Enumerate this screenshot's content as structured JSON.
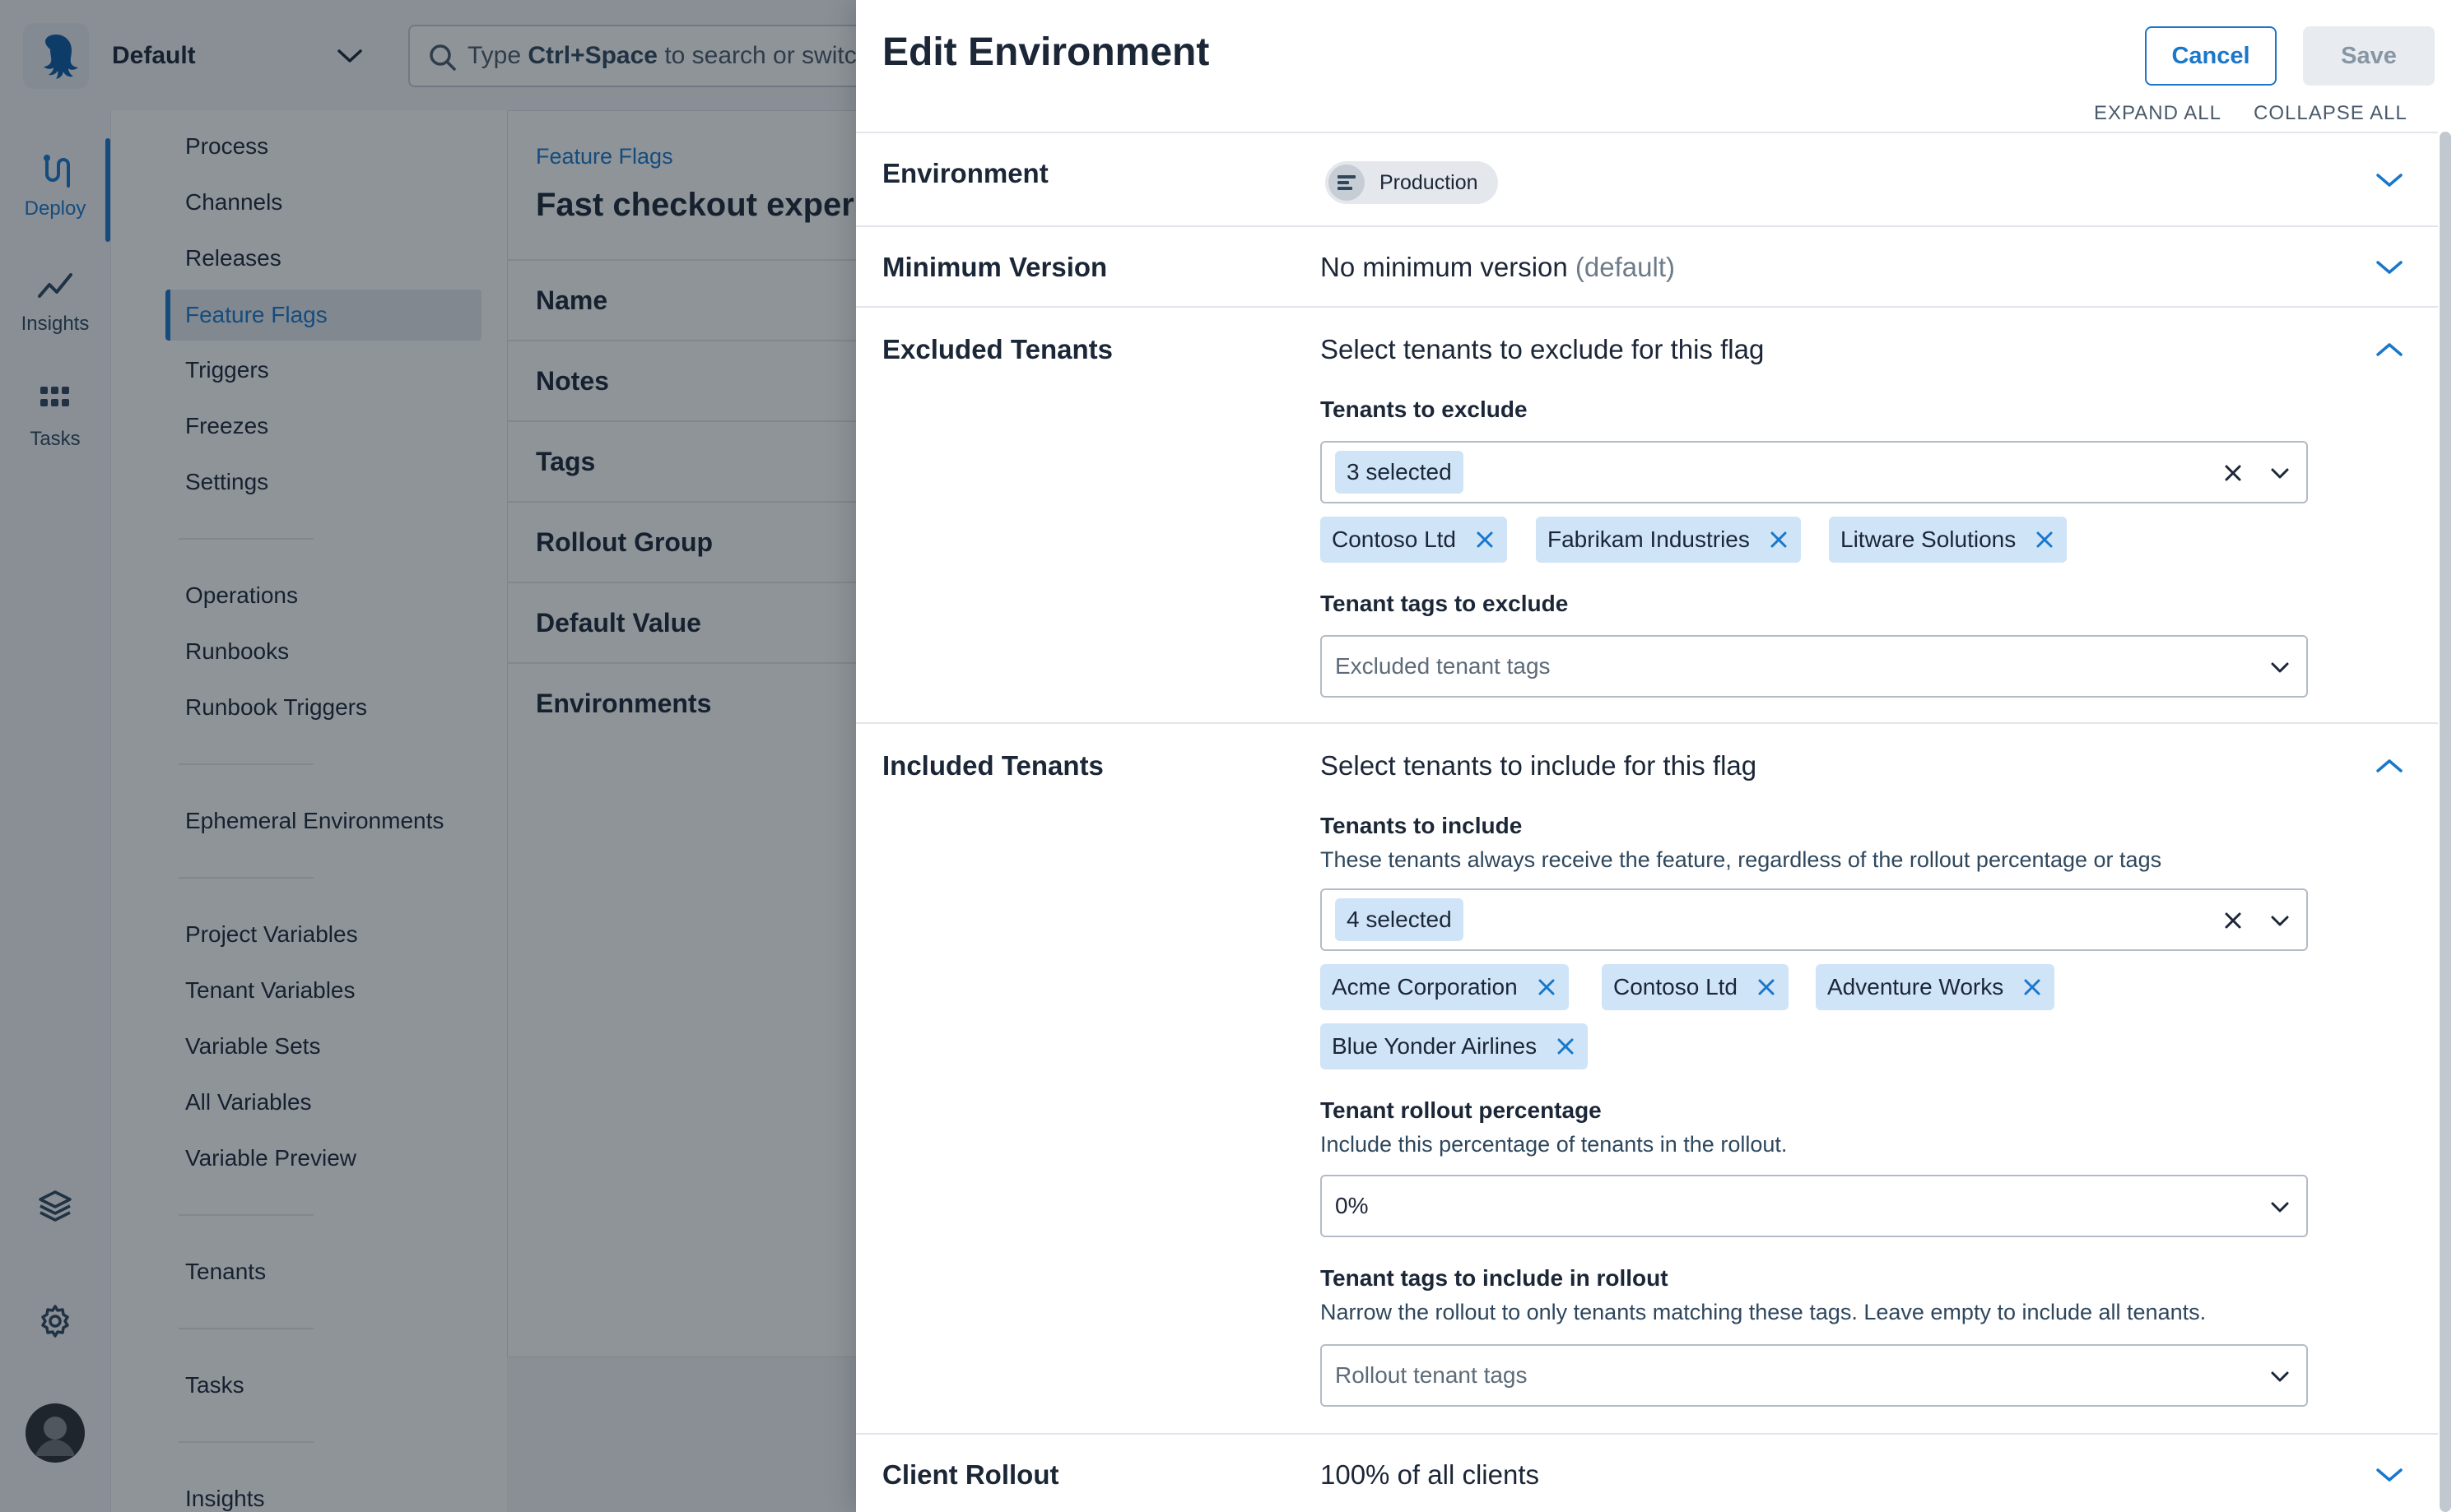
{
  "app": {
    "space": "Default",
    "search_prefix": "Type ",
    "search_key": "Ctrl+Space",
    "search_suffix": " to search or switch",
    "rail": [
      {
        "label": "Deploy"
      },
      {
        "label": "Insights"
      },
      {
        "label": "Tasks"
      }
    ]
  },
  "subnav": {
    "items": [
      "Process",
      "Channels",
      "Releases",
      "Feature Flags",
      "Triggers",
      "Freezes",
      "Settings",
      "Operations",
      "Runbooks",
      "Runbook Triggers",
      "Ephemeral Environments",
      "Project Variables",
      "Tenant Variables",
      "Variable Sets",
      "All Variables",
      "Variable Preview",
      "Tenants",
      "Tasks",
      "Insights"
    ]
  },
  "content": {
    "breadcrumb": "Feature Flags",
    "title": "Fast checkout experie",
    "rows": [
      "Name",
      "Notes",
      "Tags",
      "Rollout Group",
      "Default Value",
      "Environments"
    ]
  },
  "drawer": {
    "title": "Edit Environment",
    "cancel_label": "Cancel",
    "save_label": "Save",
    "expand_all": "EXPAND ALL",
    "collapse_all": "COLLAPSE ALL",
    "environment": {
      "label": "Environment",
      "value": "Production"
    },
    "minimum_version": {
      "label": "Minimum Version",
      "value": "No minimum version",
      "suffix": "(default)"
    },
    "excluded": {
      "label": "Excluded Tenants",
      "summary": "Select tenants to exclude for this flag",
      "tenants_label": "Tenants to exclude",
      "selected_count": "3 selected",
      "tenants": [
        "Contoso Ltd",
        "Fabrikam Industries",
        "Litware Solutions"
      ],
      "tags_label": "Tenant tags to exclude",
      "tags_placeholder": "Excluded tenant tags"
    },
    "included": {
      "label": "Included Tenants",
      "summary": "Select tenants to include for this flag",
      "tenants_label": "Tenants to include",
      "tenants_help": "These tenants always receive the feature, regardless of the rollout percentage or tags",
      "selected_count": "4 selected",
      "tenants": [
        "Acme Corporation",
        "Contoso Ltd",
        "Adventure Works",
        "Blue Yonder Airlines"
      ],
      "rollout_label": "Tenant rollout percentage",
      "rollout_help": "Include this percentage of tenants in the rollout.",
      "rollout_value": "0%",
      "rollout_tags_label": "Tenant tags to include in rollout",
      "rollout_tags_help": "Narrow the rollout to only tenants matching these tags. Leave empty to include all tenants.",
      "rollout_tags_placeholder": "Rollout tenant tags"
    },
    "client_rollout": {
      "label": "Client Rollout",
      "value": "100% of all clients"
    }
  },
  "colors": {
    "accent": "#1a77ca",
    "chip_bg": "#cfe4f7",
    "overlay": "rgba(18,27,38,0.47)"
  }
}
